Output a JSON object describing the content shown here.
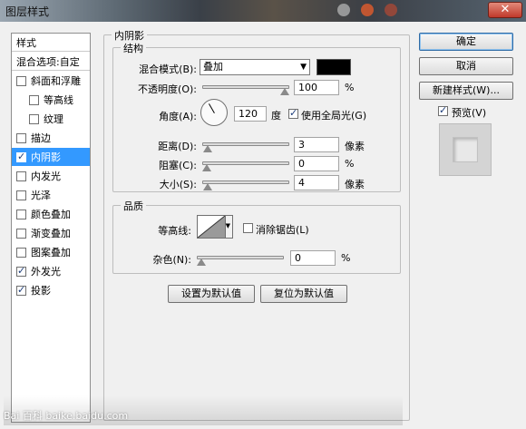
{
  "window": {
    "title": "图层样式",
    "close_label": "✕"
  },
  "styles_panel": {
    "header": "样式",
    "blend_options": "混合选项:自定",
    "items": [
      {
        "label": "斜面和浮雕",
        "checked": false,
        "indent": false,
        "selected": false
      },
      {
        "label": "等高线",
        "checked": false,
        "indent": true,
        "selected": false
      },
      {
        "label": "纹理",
        "checked": false,
        "indent": true,
        "selected": false
      },
      {
        "label": "描边",
        "checked": false,
        "indent": false,
        "selected": false
      },
      {
        "label": "内阴影",
        "checked": true,
        "indent": false,
        "selected": true
      },
      {
        "label": "内发光",
        "checked": false,
        "indent": false,
        "selected": false
      },
      {
        "label": "光泽",
        "checked": false,
        "indent": false,
        "selected": false
      },
      {
        "label": "颜色叠加",
        "checked": false,
        "indent": false,
        "selected": false
      },
      {
        "label": "渐变叠加",
        "checked": false,
        "indent": false,
        "selected": false
      },
      {
        "label": "图案叠加",
        "checked": false,
        "indent": false,
        "selected": false
      },
      {
        "label": "外发光",
        "checked": true,
        "indent": false,
        "selected": false
      },
      {
        "label": "投影",
        "checked": true,
        "indent": false,
        "selected": false
      }
    ]
  },
  "inner_shadow": {
    "title": "内阴影",
    "structure": {
      "title": "结构",
      "blend_mode_label": "混合模式(B):",
      "blend_mode_value": "叠加",
      "blend_color": "#000000",
      "opacity_label": "不透明度(O):",
      "opacity_value": "100",
      "opacity_unit": "%",
      "opacity_fraction": 1.0,
      "angle_label": "角度(A):",
      "angle_value": "120",
      "angle_unit": "度",
      "global_light_label": "使用全局光(G)",
      "global_light_checked": true,
      "distance_label": "距离(D):",
      "distance_value": "3",
      "distance_unit": "像素",
      "distance_fraction": 0.012,
      "choke_label": "阻塞(C):",
      "choke_value": "0",
      "choke_unit": "%",
      "choke_fraction": 0.0,
      "size_label": "大小(S):",
      "size_value": "4",
      "size_unit": "像素",
      "size_fraction": 0.016
    },
    "quality": {
      "title": "品质",
      "contour_label": "等高线:",
      "anti_alias_label": "消除锯齿(L)",
      "anti_alias_checked": false,
      "noise_label": "杂色(N):",
      "noise_value": "0",
      "noise_unit": "%",
      "noise_fraction": 0.0
    },
    "make_default_label": "设置为默认值",
    "reset_default_label": "复位为默认值"
  },
  "actions": {
    "ok_label": "确定",
    "cancel_label": "取消",
    "new_style_label": "新建样式(W)...",
    "preview_label": "预览(V)",
    "preview_checked": true
  },
  "watermark": "Bai 百科 baike.baidu.com"
}
